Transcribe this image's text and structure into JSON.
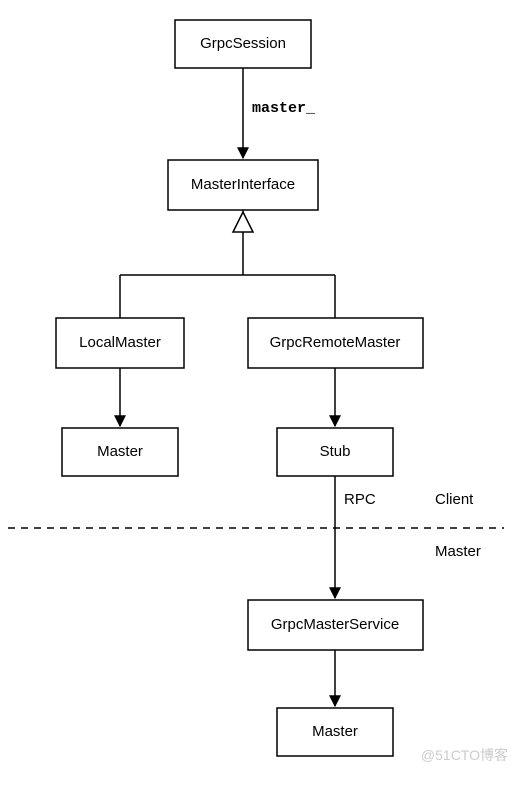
{
  "nodes": {
    "grpc_session": "GrpcSession",
    "master_interface": "MasterInterface",
    "local_master": "LocalMaster",
    "grpc_remote_master": "GrpcRemoteMaster",
    "master_left": "Master",
    "stub": "Stub",
    "grpc_master_service": "GrpcMasterService",
    "master_bottom": "Master"
  },
  "edges": {
    "master_ptr": "master_",
    "rpc": "RPC"
  },
  "regions": {
    "client": "Client",
    "master": "Master"
  },
  "watermark": "@51CTO博客"
}
